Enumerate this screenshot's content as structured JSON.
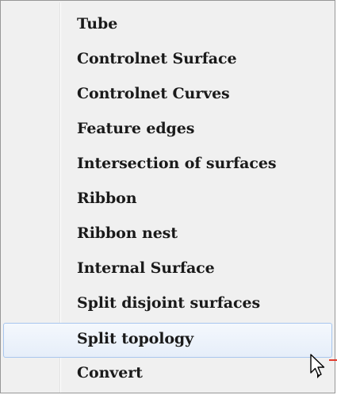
{
  "menu": {
    "items": [
      {
        "label": "Tube",
        "highlighted": false,
        "has_submenu": false
      },
      {
        "label": "Controlnet Surface",
        "highlighted": false,
        "has_submenu": false
      },
      {
        "label": "Controlnet Curves",
        "highlighted": false,
        "has_submenu": false
      },
      {
        "label": "Feature edges",
        "highlighted": false,
        "has_submenu": false
      },
      {
        "label": "Intersection of surfaces",
        "highlighted": false,
        "has_submenu": false
      },
      {
        "label": "Ribbon",
        "highlighted": false,
        "has_submenu": false
      },
      {
        "label": "Ribbon nest",
        "highlighted": false,
        "has_submenu": false
      },
      {
        "label": "Internal Surface",
        "highlighted": false,
        "has_submenu": false
      },
      {
        "label": "Split disjoint surfaces",
        "highlighted": false,
        "has_submenu": false
      },
      {
        "label": "Split topology",
        "highlighted": true,
        "has_submenu": false
      },
      {
        "label": "Convert",
        "highlighted": false,
        "has_submenu": true
      }
    ]
  },
  "colors": {
    "menu_background": "#f0f0f0",
    "highlight_border": "#a8c6ee",
    "text": "#1a1a1a"
  },
  "icons": {
    "submenu": "triangle-right-icon",
    "cursor": "arrow-cursor-icon"
  }
}
